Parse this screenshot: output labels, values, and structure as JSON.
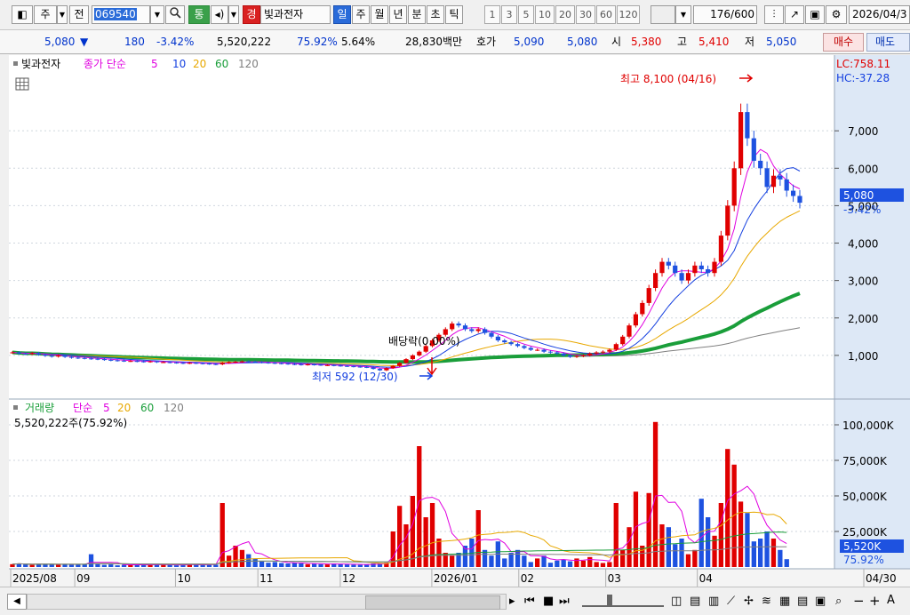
{
  "toolbar": {
    "market_select": "주",
    "type_select": "전",
    "stock_code": "069540",
    "broadcast_label": "통",
    "market_badge": "경",
    "stock_name": "빛과전자",
    "periods": [
      "일",
      "주",
      "월",
      "년",
      "분",
      "초",
      "틱"
    ],
    "active_period": "일",
    "minute_steps": [
      "1",
      "3",
      "5",
      "10",
      "20",
      "30",
      "60",
      "120"
    ],
    "count_value": "176",
    "count_total": "/600",
    "date_value": "2026/04/3"
  },
  "quote": {
    "price": "5,080",
    "arrow": "▼",
    "change": "180",
    "change_pct": "-3.42%",
    "volume": "5,520,222",
    "vol_ratio": "75.92%",
    "turnover": "5.64%",
    "amount": "28,830백만",
    "ask_label": "호가",
    "ask": "5,090",
    "bid": "5,080",
    "open_label": "시",
    "open": "5,380",
    "high_label": "고",
    "high": "5,410",
    "low_label": "저",
    "low": "5,050",
    "buy_label": "매수",
    "sell_label": "매도"
  },
  "colors": {
    "up": "#e00000",
    "down": "#1e52e0",
    "ma5": "#e000e0",
    "ma10": "#1540e0",
    "ma20": "#e8a800",
    "ma60": "#1a9e3a",
    "ma120": "#808080"
  },
  "price_panel": {
    "legend_name": "빛과전자",
    "legend_type": "종가 단순",
    "periods": [
      "5",
      "10",
      "20",
      "60",
      "120"
    ],
    "lc_label": "LC:758.11",
    "hc_label": "HC:-37.28",
    "current_price": "5,080",
    "current_change": "-3.42%",
    "high_note": "최고 8,100 (04/16)",
    "low_note": "최저 592 (12/30)",
    "dividend_note": "배당락(0.00%)"
  },
  "volume_panel": {
    "legend_name": "거래량",
    "legend_type": "단순",
    "periods": [
      "5",
      "20",
      "60",
      "120"
    ],
    "summary": "5,520,222주(75.92%)",
    "current_volume": "5,520K",
    "current_ratio": "75.92%"
  },
  "chart_data": {
    "type": "candlestick",
    "price_axis": {
      "min": 0,
      "max": 8500,
      "ticks": [
        "1,000",
        "2,000",
        "3,000",
        "4,000",
        "5,000",
        "6,000",
        "7,000"
      ]
    },
    "volume_axis": {
      "min": 0,
      "max": 110000,
      "unit": "K",
      "ticks": [
        "25,000K",
        "50,000K",
        "75,000K",
        "100,000K"
      ]
    },
    "x_labels": [
      "2025/08",
      "09",
      "10",
      "11",
      "12",
      "2026/01",
      "02",
      "03",
      "04",
      "04/30"
    ],
    "closes": [
      1080,
      1050,
      1040,
      1060,
      1020,
      990,
      970,
      1000,
      960,
      940,
      930,
      920,
      910,
      900,
      880,
      870,
      860,
      850,
      850,
      840,
      830,
      840,
      820,
      820,
      810,
      800,
      790,
      800,
      790,
      780,
      770,
      760,
      800,
      820,
      830,
      840,
      830,
      820,
      810,
      800,
      790,
      780,
      770,
      760,
      750,
      760,
      750,
      740,
      740,
      730,
      720,
      710,
      700,
      690,
      680,
      640,
      600,
      660,
      720,
      800,
      900,
      1000,
      1100,
      1250,
      1400,
      1550,
      1700,
      1850,
      1800,
      1700,
      1650,
      1700,
      1600,
      1500,
      1400,
      1350,
      1300,
      1250,
      1200,
      1150,
      1150,
      1100,
      1080,
      1050,
      1000,
      960,
      980,
      1000,
      1050,
      1080,
      1100,
      1150,
      1300,
      1500,
      1800,
      2100,
      2400,
      2800,
      3200,
      3500,
      3400,
      3200,
      3000,
      3200,
      3400,
      3300,
      3200,
      3500,
      4200,
      5000,
      6000,
      7500,
      6800,
      6200,
      6000,
      5500,
      5800,
      5700,
      5400,
      5260,
      5080
    ],
    "volumes": [
      2000,
      2500,
      1800,
      1500,
      2200,
      2000,
      1800,
      1700,
      2100,
      1600,
      2200,
      1800,
      9000,
      2000,
      1500,
      1800,
      1200,
      1500,
      1800,
      1500,
      1700,
      1400,
      1600,
      1800,
      1500,
      1200,
      1500,
      2000,
      1800,
      1400,
      1500,
      1700,
      45000,
      8000,
      15000,
      12000,
      9000,
      6000,
      4000,
      3000,
      3500,
      2800,
      2500,
      3000,
      2500,
      2000,
      2200,
      2000,
      1800,
      2500,
      2000,
      1800,
      1600,
      1500,
      2000,
      2500,
      2800,
      3000,
      25000,
      43000,
      30000,
      50000,
      85000,
      35000,
      45000,
      20000,
      10000,
      8000,
      10000,
      15000,
      20000,
      40000,
      12000,
      8000,
      18000,
      6000,
      10000,
      12000,
      8000,
      3500,
      6000,
      8000,
      3000,
      4500,
      5000,
      4000,
      6000,
      4500,
      7000,
      3500,
      2800,
      3500,
      45000,
      12000,
      28000,
      53000,
      15000,
      52000,
      102000,
      30000,
      28000,
      16000,
      20000,
      9000,
      12000,
      48000,
      35000,
      22000,
      45000,
      83000,
      72000,
      46000,
      38000,
      18000,
      20000,
      25000,
      20000,
      12000,
      5520
    ],
    "series": [
      {
        "name": "종가",
        "type": "candlestick"
      },
      {
        "name": "5",
        "type": "ma"
      },
      {
        "name": "10",
        "type": "ma"
      },
      {
        "name": "20",
        "type": "ma"
      },
      {
        "name": "60",
        "type": "ma"
      },
      {
        "name": "120",
        "type": "ma"
      }
    ]
  }
}
